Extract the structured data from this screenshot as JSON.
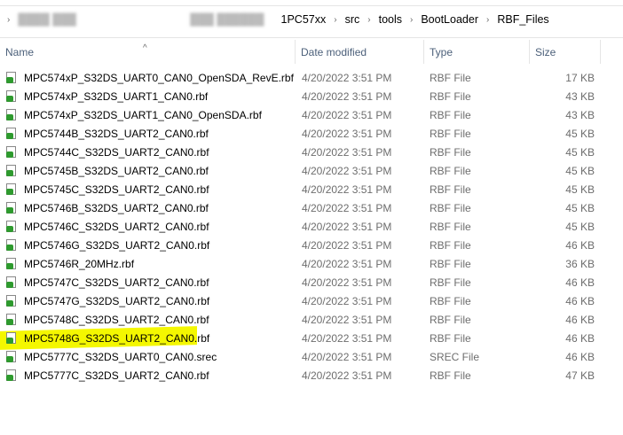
{
  "breadcrumb": {
    "partial": "1PC57xx",
    "items": [
      "src",
      "tools",
      "BootLoader",
      "RBF_Files"
    ]
  },
  "columns": {
    "name": "Name",
    "date": "Date modified",
    "type": "Type",
    "size": "Size"
  },
  "files": [
    {
      "name": "MPC574xP_S32DS_UART0_CAN0_OpenSDA_RevE.rbf",
      "date": "4/20/2022 3:51 PM",
      "type": "RBF File",
      "size": "17 KB"
    },
    {
      "name": "MPC574xP_S32DS_UART1_CAN0.rbf",
      "date": "4/20/2022 3:51 PM",
      "type": "RBF File",
      "size": "43 KB"
    },
    {
      "name": "MPC574xP_S32DS_UART1_CAN0_OpenSDA.rbf",
      "date": "4/20/2022 3:51 PM",
      "type": "RBF File",
      "size": "43 KB"
    },
    {
      "name": "MPC5744B_S32DS_UART2_CAN0.rbf",
      "date": "4/20/2022 3:51 PM",
      "type": "RBF File",
      "size": "45 KB"
    },
    {
      "name": "MPC5744C_S32DS_UART2_CAN0.rbf",
      "date": "4/20/2022 3:51 PM",
      "type": "RBF File",
      "size": "45 KB"
    },
    {
      "name": "MPC5745B_S32DS_UART2_CAN0.rbf",
      "date": "4/20/2022 3:51 PM",
      "type": "RBF File",
      "size": "45 KB"
    },
    {
      "name": "MPC5745C_S32DS_UART2_CAN0.rbf",
      "date": "4/20/2022 3:51 PM",
      "type": "RBF File",
      "size": "45 KB"
    },
    {
      "name": "MPC5746B_S32DS_UART2_CAN0.rbf",
      "date": "4/20/2022 3:51 PM",
      "type": "RBF File",
      "size": "45 KB"
    },
    {
      "name": "MPC5746C_S32DS_UART2_CAN0.rbf",
      "date": "4/20/2022 3:51 PM",
      "type": "RBF File",
      "size": "45 KB"
    },
    {
      "name": "MPC5746G_S32DS_UART2_CAN0.rbf",
      "date": "4/20/2022 3:51 PM",
      "type": "RBF File",
      "size": "46 KB"
    },
    {
      "name": "MPC5746R_20MHz.rbf",
      "date": "4/20/2022 3:51 PM",
      "type": "RBF File",
      "size": "36 KB"
    },
    {
      "name": "MPC5747C_S32DS_UART2_CAN0.rbf",
      "date": "4/20/2022 3:51 PM",
      "type": "RBF File",
      "size": "46 KB"
    },
    {
      "name": "MPC5747G_S32DS_UART2_CAN0.rbf",
      "date": "4/20/2022 3:51 PM",
      "type": "RBF File",
      "size": "46 KB"
    },
    {
      "name": "MPC5748C_S32DS_UART2_CAN0.rbf",
      "date": "4/20/2022 3:51 PM",
      "type": "RBF File",
      "size": "46 KB"
    },
    {
      "name": "MPC5748G_S32DS_UART2_CAN0.rbf",
      "date": "4/20/2022 3:51 PM",
      "type": "RBF File",
      "size": "46 KB",
      "highlighted": true
    },
    {
      "name": "MPC5777C_S32DS_UART0_CAN0.srec",
      "date": "4/20/2022 3:51 PM",
      "type": "SREC File",
      "size": "46 KB"
    },
    {
      "name": "MPC5777C_S32DS_UART2_CAN0.rbf",
      "date": "4/20/2022 3:51 PM",
      "type": "RBF File",
      "size": "47 KB"
    }
  ],
  "colors": {
    "highlight": "#f4f700",
    "icon": "#2e9a2e",
    "header_text": "#4c607a"
  }
}
